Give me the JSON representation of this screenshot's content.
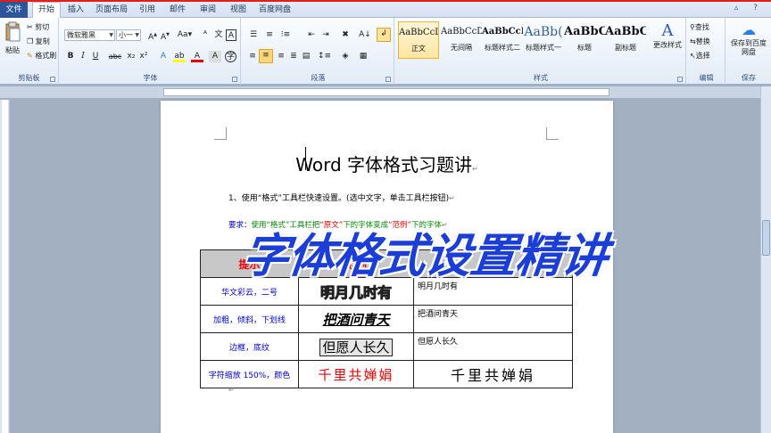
{
  "tabs": [
    {
      "label": "文件",
      "active": false
    },
    {
      "label": "开始",
      "active": true
    },
    {
      "label": "插入",
      "active": false
    },
    {
      "label": "页面布局",
      "active": false
    },
    {
      "label": "引用",
      "active": false
    },
    {
      "label": "邮件",
      "active": false
    },
    {
      "label": "审阅",
      "active": false
    },
    {
      "label": "视图",
      "active": false
    },
    {
      "label": "百度网盘",
      "active": false
    }
  ],
  "ribbon": {
    "clipboard": {
      "label": "剪贴板",
      "paste": "粘贴",
      "cut": "剪切",
      "copy": "复制",
      "painter": "格式刷"
    },
    "font": {
      "label": "字体",
      "font_name": "微软雅黑",
      "font_size": "小一",
      "bold": "B",
      "italic": "I",
      "underline": "U",
      "strike": "abc",
      "sub": "x₂",
      "sup": "x²"
    },
    "paragraph": {
      "label": "段落"
    },
    "styles": {
      "label": "样式",
      "items": [
        {
          "preview": "AaBbCcDd",
          "name": "正文"
        },
        {
          "preview": "AaBbCcDd",
          "name": "无间隔"
        },
        {
          "preview": "AaBbCcD",
          "name": "标题样式二"
        },
        {
          "preview": "AaBb(",
          "name": "标题样式一"
        },
        {
          "preview": "AaBbC",
          "name": "标题"
        },
        {
          "preview": "AaBbC",
          "name": "副标题"
        }
      ],
      "change_styles": "更改样式"
    },
    "editing": {
      "label": "编辑",
      "find": "查找",
      "replace": "替换",
      "select": "选择"
    },
    "save": {
      "label": "保存",
      "button": "保存到百度网盘"
    }
  },
  "document": {
    "title": "Word 字体格式习题讲",
    "para1": "1、使用“格式”工具栏快速设置。(选中文字，单击工具栏按钮)",
    "para2": {
      "p1": "要求：",
      "p2": "使用“格式”工具栏把",
      "p3": "“原文”",
      "p4": "下的字体变成",
      "p5": "“范例”",
      "p6": "下的字体"
    },
    "table": {
      "headers": [
        "提示",
        "范例",
        "原文"
      ],
      "rows": [
        {
          "hint": "华文彩云，二号",
          "sample": "明月几时有",
          "original": "明月几时有"
        },
        {
          "hint": "加粗，倾斜，下划线",
          "sample": "把酒问青天",
          "original": "把酒问青天"
        },
        {
          "hint": "边框，底纹",
          "sample": "但愿人长久",
          "original": "但愿人长久"
        },
        {
          "hint": "字符缩放 150%，颜色",
          "sample": "千里共婵娟",
          "original": "千里共婵娟"
        }
      ]
    },
    "overlay_caption": "字体格式设置精讲"
  },
  "colors": {
    "accent": "#2b579a",
    "red": "#e00000",
    "blue": "#0000cc",
    "green": "#008a00",
    "overlay": "#1b3fd6"
  }
}
